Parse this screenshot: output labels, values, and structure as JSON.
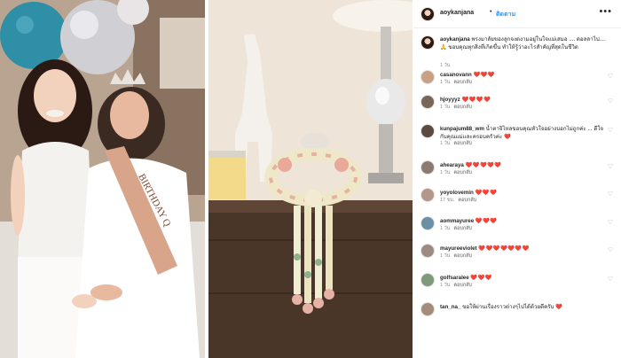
{
  "post": {
    "username": "aoykanjana",
    "separator": "•",
    "follow_label": "ติดตาม",
    "more_icon": "more-horizontal-icon",
    "caption": {
      "username": "aoykanjana",
      "text": "พรงมาลัยของลูกจงดงามอยู่ในใจแม่เสมอ .... ดอลลาไป.... 🙏 ขอบคุณทุกสิ่งที่เกิดขึ้น ทำให้รู้ว่าอะไรสำคัญที่สุดในชีวิต",
      "time": "1 วัน"
    },
    "comments": [
      {
        "username": "casanovann",
        "text": "",
        "hearts": "❤️❤️❤️",
        "time": "1 วัน",
        "reply": "ตอบกลับ"
      },
      {
        "username": "hjoyyyz",
        "text": "",
        "hearts": "❤️❤️❤️❤️",
        "time": "1 วัน",
        "reply": "ตอบกลับ"
      },
      {
        "username": "kunpajum88_wm",
        "text": "น้ำตาจิไหลขอบคุณหัวใจอย่างบอกไม่ถูกค่ะ ... ดีใจกับคุณแม่และครอบครัวค่ะ",
        "hearts": "❤️",
        "time": "1 วัน",
        "reply": "ตอบกลับ"
      },
      {
        "username": "ahearaya",
        "text": "",
        "hearts": "❤️❤️❤️❤️❤️",
        "time": "1 วัน",
        "reply": "ตอบกลับ"
      },
      {
        "username": "yoyolovemin",
        "text": "",
        "hearts": "❤️❤️❤️",
        "time": "17 ชม.",
        "reply": "ตอบกลับ"
      },
      {
        "username": "aommayuree",
        "text": "",
        "hearts": "❤️❤️❤️",
        "time": "1 วัน",
        "reply": "ตอบกลับ"
      },
      {
        "username": "mayureeviolet",
        "text": "",
        "hearts": "❤️❤️❤️❤️❤️❤️❤️",
        "time": "1 วัน",
        "reply": "ตอบกลับ"
      },
      {
        "username": "golfsaralee",
        "text": "",
        "hearts": "❤️❤️❤️",
        "time": "1 วัน",
        "reply": "ตอบกลับ"
      },
      {
        "username": "tan_na_",
        "text": "ขอให้ผ่านเรื่องราวต่างๆไปได้ด้วยดีครับ",
        "hearts": "❤️",
        "time": "",
        "reply": ""
      }
    ],
    "like_icon": "♡"
  },
  "photos": {
    "left_sash_text": "BIRTHDAY Q"
  },
  "colors": {
    "link_blue": "#3897f0",
    "heart_red": "#ed4956",
    "meta_gray": "#8e8e8e"
  }
}
